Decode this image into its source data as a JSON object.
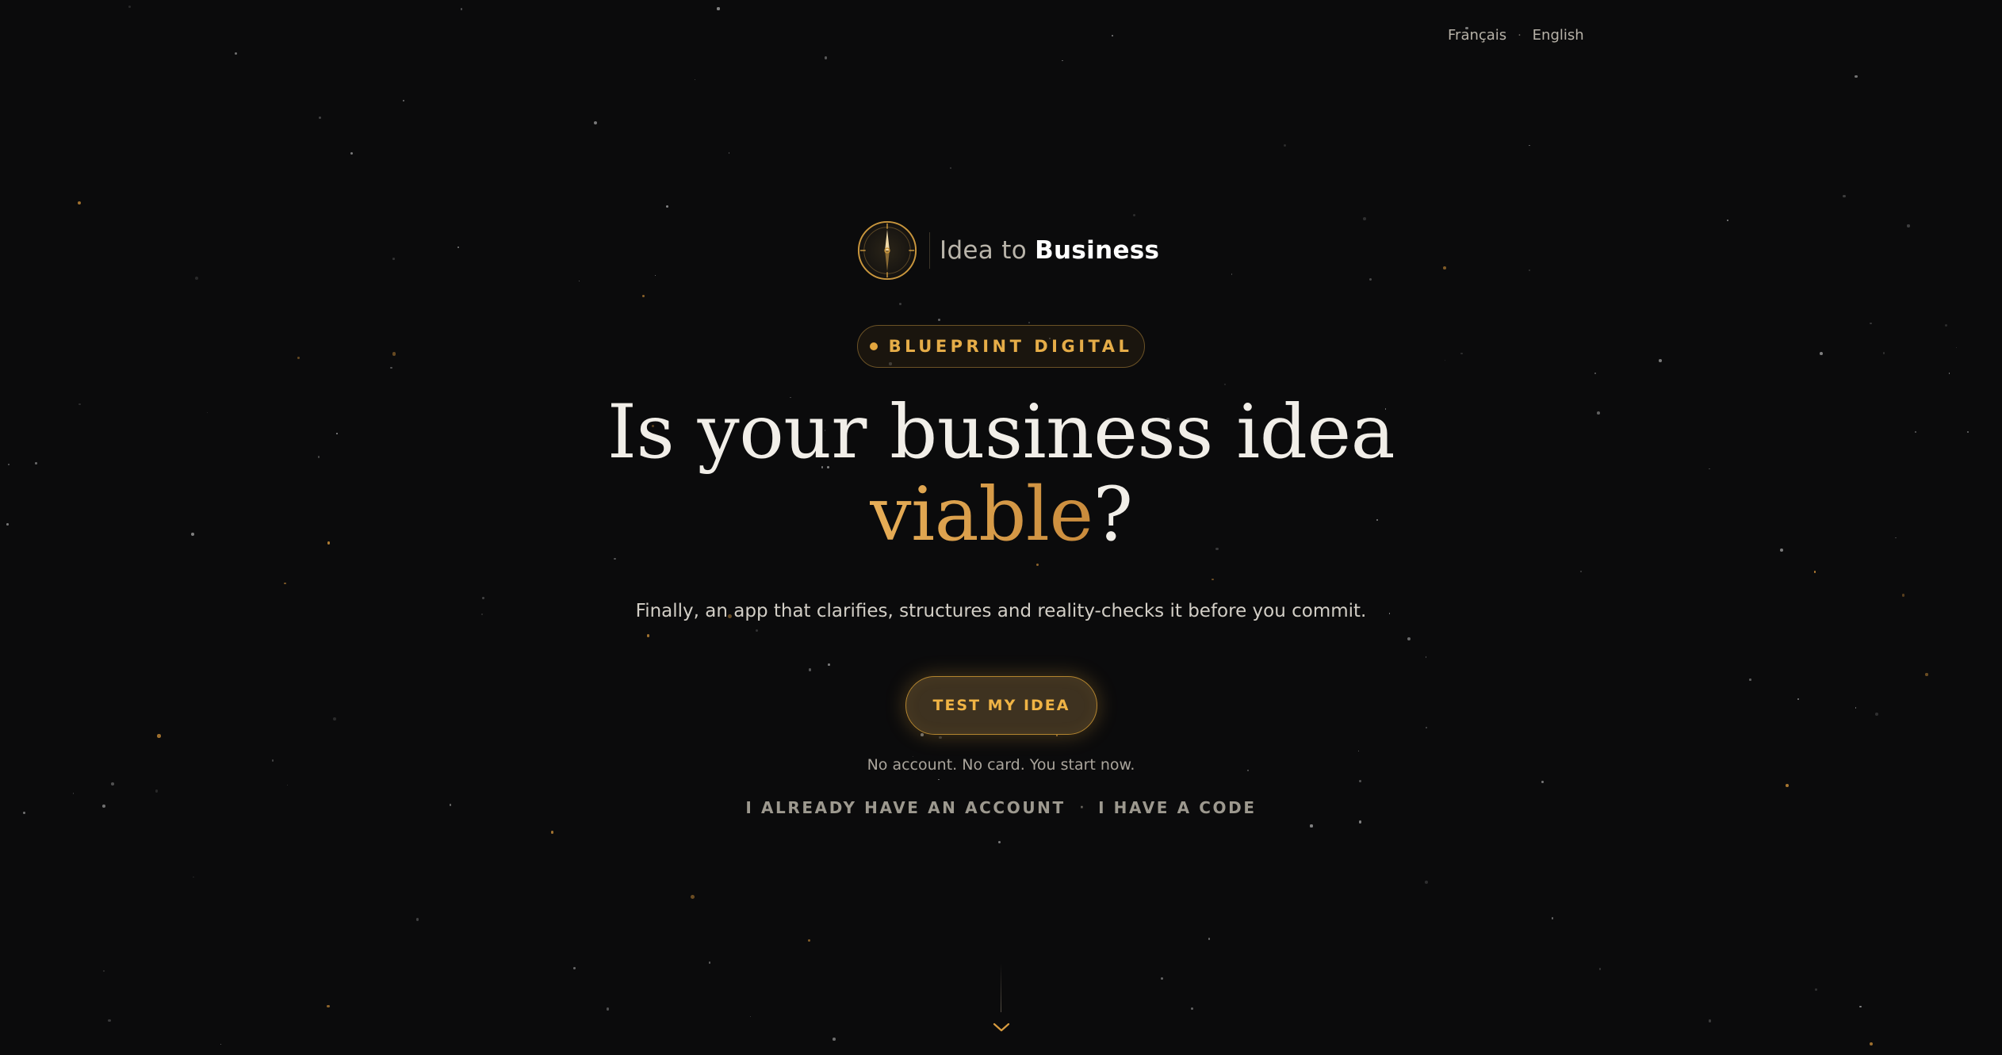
{
  "language_switcher": {
    "items": [
      "Français",
      "English"
    ],
    "separator": "·"
  },
  "brand": {
    "name_light": "Idea to",
    "name_bold": "Business",
    "logo_icon": "compass-icon"
  },
  "badge": {
    "label": "BLUEPRINT DIGITAL"
  },
  "hero": {
    "headline_line1": "Is your business idea",
    "headline_accent": "viable",
    "headline_end": "?",
    "subtitle": "Finally, an app that clarifies, structures and reality-checks it before you commit."
  },
  "cta": {
    "label": "TEST MY IDEA",
    "note": "No account. No card. You start now."
  },
  "secondary_links": {
    "login": "I ALREADY HAVE AN ACCOUNT",
    "separator": "·",
    "code": "I HAVE A CODE"
  },
  "scroll_indicator": {
    "icon": "chevron-down-icon"
  },
  "colors": {
    "background": "#0b0b0c",
    "accent_gold": "#e6ad48",
    "text_primary": "#f1eee8",
    "text_muted": "#aaa59c"
  }
}
